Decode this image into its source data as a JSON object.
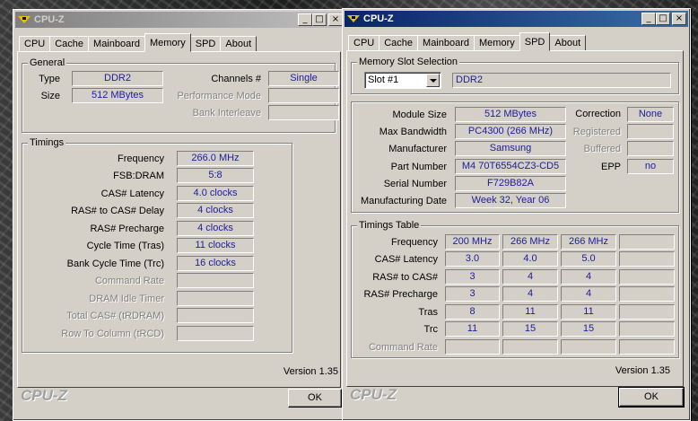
{
  "colors": {
    "value_text": "#1c1c9c",
    "active_title": "#0a246a",
    "inactive_title": "#808080",
    "window_bg": "#d4d0c8"
  },
  "left_window": {
    "title": "CPU-Z",
    "tabs": [
      "CPU",
      "Cache",
      "Mainboard",
      "Memory",
      "SPD",
      "About"
    ],
    "selected_tab": "Memory",
    "general": {
      "title": "General",
      "type_label": "Type",
      "type_value": "DDR2",
      "size_label": "Size",
      "size_value": "512 MBytes",
      "channels_label": "Channels #",
      "channels_value": "Single",
      "perf_mode_label": "Performance Mode",
      "perf_mode_value": "",
      "bank_interleave_label": "Bank Interleave",
      "bank_interleave_value": ""
    },
    "timings": {
      "title": "Timings",
      "rows": [
        {
          "label": "Frequency",
          "value": "266.0 MHz",
          "enabled": true
        },
        {
          "label": "FSB:DRAM",
          "value": "5:8",
          "enabled": true
        },
        {
          "label": "CAS# Latency",
          "value": "4.0 clocks",
          "enabled": true
        },
        {
          "label": "RAS# to CAS# Delay",
          "value": "4 clocks",
          "enabled": true
        },
        {
          "label": "RAS# Precharge",
          "value": "4 clocks",
          "enabled": true
        },
        {
          "label": "Cycle Time (Tras)",
          "value": "11 clocks",
          "enabled": true
        },
        {
          "label": "Bank Cycle Time (Trc)",
          "value": "16 clocks",
          "enabled": true
        },
        {
          "label": "Command Rate",
          "value": "",
          "enabled": false
        },
        {
          "label": "DRAM Idle Timer",
          "value": "",
          "enabled": false
        },
        {
          "label": "Total CAS# (tRDRAM)",
          "value": "",
          "enabled": false
        },
        {
          "label": "Row To Column (tRCD)",
          "value": "",
          "enabled": false
        }
      ]
    },
    "version": "Version 1.35",
    "logo": "CPU-Z",
    "ok_label": "OK"
  },
  "right_window": {
    "title": "CPU-Z",
    "tabs": [
      "CPU",
      "Cache",
      "Mainboard",
      "Memory",
      "SPD",
      "About"
    ],
    "selected_tab": "SPD",
    "slot_selection": {
      "title": "Memory Slot Selection",
      "selected_slot": "Slot #1",
      "slot_type": "DDR2"
    },
    "module": {
      "module_size_label": "Module Size",
      "module_size": "512 MBytes",
      "max_bandwidth_label": "Max Bandwidth",
      "max_bandwidth": "PC4300 (266 MHz)",
      "manufacturer_label": "Manufacturer",
      "manufacturer": "Samsung",
      "part_number_label": "Part Number",
      "part_number": "M4 70T6554CZ3-CD5",
      "serial_number_label": "Serial Number",
      "serial_number": "F729B82A",
      "mfg_date_label": "Manufacturing Date",
      "mfg_date": "Week 32, Year 06",
      "correction_label": "Correction",
      "correction": "None",
      "registered_label": "Registered",
      "registered": "",
      "buffered_label": "Buffered",
      "buffered": "",
      "epp_label": "EPP",
      "epp": "no"
    },
    "timings_table": {
      "title": "Timings Table",
      "rows": [
        {
          "label": "Frequency",
          "values": [
            "200 MHz",
            "266 MHz",
            "266 MHz",
            ""
          ],
          "enabled": true
        },
        {
          "label": "CAS# Latency",
          "values": [
            "3.0",
            "4.0",
            "5.0",
            ""
          ],
          "enabled": true
        },
        {
          "label": "RAS# to CAS#",
          "values": [
            "3",
            "4",
            "4",
            ""
          ],
          "enabled": true
        },
        {
          "label": "RAS# Precharge",
          "values": [
            "3",
            "4",
            "4",
            ""
          ],
          "enabled": true
        },
        {
          "label": "Tras",
          "values": [
            "8",
            "11",
            "11",
            ""
          ],
          "enabled": true
        },
        {
          "label": "Trc",
          "values": [
            "11",
            "15",
            "15",
            ""
          ],
          "enabled": true
        },
        {
          "label": "Command Rate",
          "values": [
            "",
            "",
            "",
            ""
          ],
          "enabled": false
        }
      ]
    },
    "version": "Version 1.35",
    "logo": "CPU-Z",
    "ok_label": "OK"
  }
}
